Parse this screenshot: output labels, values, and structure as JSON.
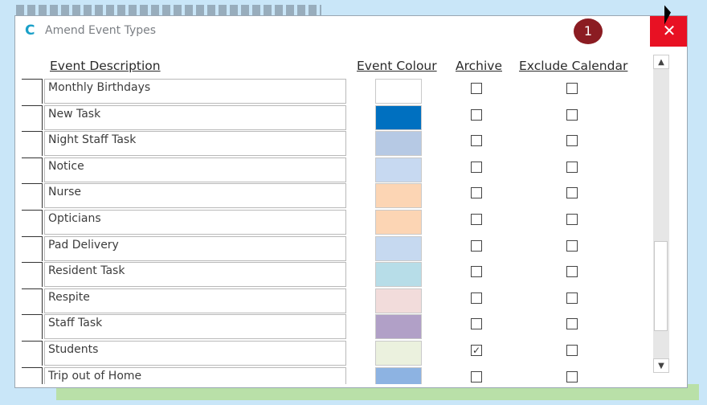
{
  "window": {
    "title": "Amend Event Types",
    "logo_letter": "C",
    "badge": "1",
    "close_label": "✕"
  },
  "headers": {
    "description": "Event Description",
    "colour": "Event Colour",
    "archive": "Archive",
    "exclude": "Exclude Calendar"
  },
  "rows": [
    {
      "description": "Monthly Birthdays",
      "colour": "#ffffff",
      "archive": false,
      "exclude": false
    },
    {
      "description": "New Task",
      "colour": "#0070c0",
      "archive": false,
      "exclude": false
    },
    {
      "description": "Night Staff Task",
      "colour": "#b6c9e4",
      "archive": false,
      "exclude": false
    },
    {
      "description": "Notice",
      "colour": "#c7d9f1",
      "archive": false,
      "exclude": false
    },
    {
      "description": "Nurse",
      "colour": "#fcd5b4",
      "archive": false,
      "exclude": false
    },
    {
      "description": "Opticians",
      "colour": "#fcd5b4",
      "archive": false,
      "exclude": false
    },
    {
      "description": "Pad Delivery",
      "colour": "#c6d9f0",
      "archive": false,
      "exclude": false
    },
    {
      "description": "Resident Task",
      "colour": "#b7dde8",
      "archive": false,
      "exclude": false
    },
    {
      "description": "Respite",
      "colour": "#f2dcdb",
      "archive": false,
      "exclude": false
    },
    {
      "description": "Staff Task",
      "colour": "#b1a0c7",
      "archive": false,
      "exclude": false
    },
    {
      "description": "Students",
      "colour": "#ebf1de",
      "archive": true,
      "exclude": false
    },
    {
      "description": "Trip out of Home",
      "colour": "#8db3e2",
      "archive": false,
      "exclude": false
    }
  ],
  "scrollbar": {
    "up": "▲",
    "down": "▼"
  }
}
